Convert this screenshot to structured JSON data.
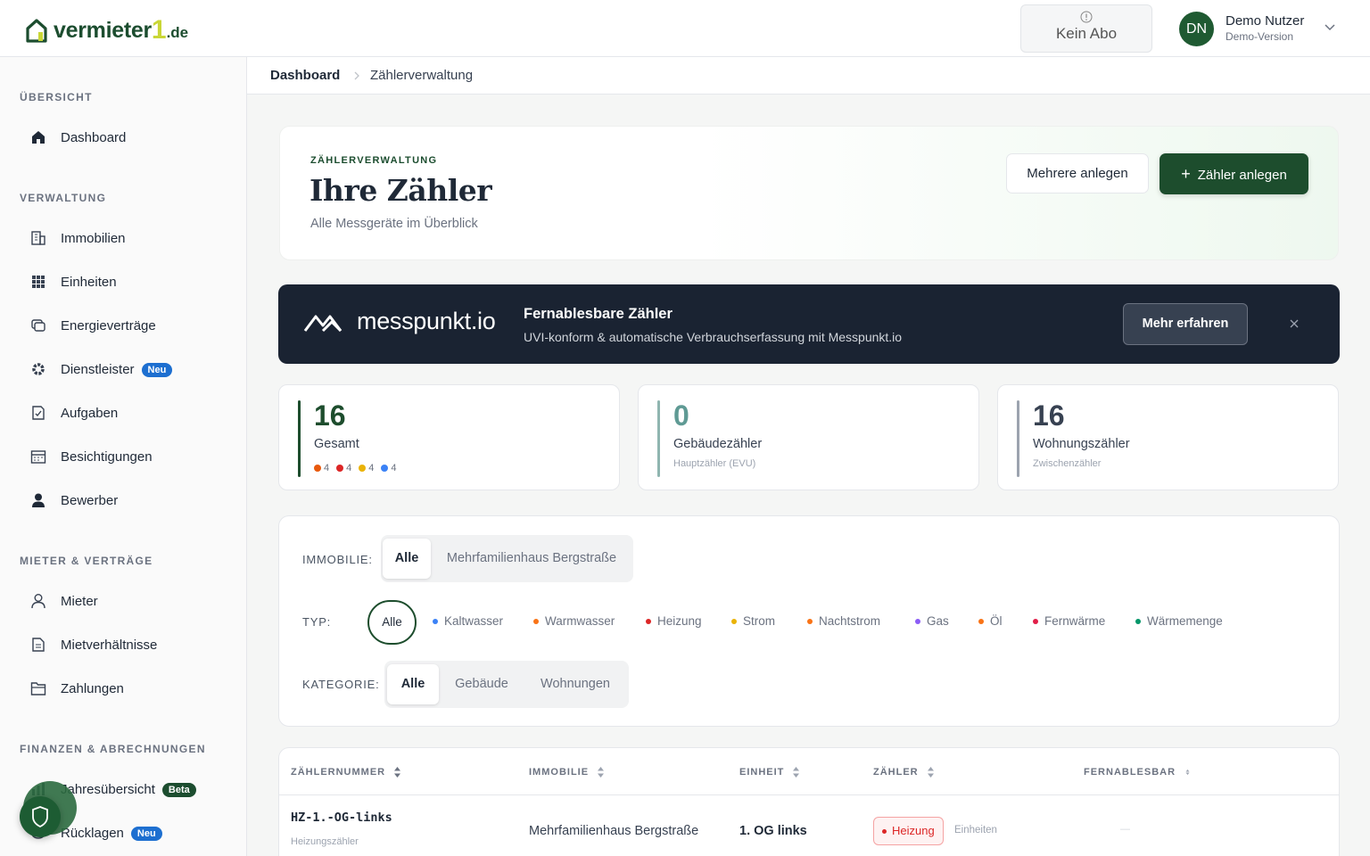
{
  "header": {
    "logo_text": "vermieter",
    "logo_one": "1",
    "logo_domain": ".de",
    "abo_label": "Kein Abo",
    "avatar_initials": "DN",
    "user_name": "Demo Nutzer",
    "user_role": "Demo-Version"
  },
  "sidebar": {
    "sections": [
      "ÜBERSICHT",
      "VERWALTUNG",
      "MIETER & VERTRÄGE",
      "FINANZEN & ABRECHNUNGEN"
    ],
    "items": [
      {
        "label": "Dashboard",
        "icon": "home-icon"
      },
      {
        "label": "Immobilien",
        "icon": "building-icon"
      },
      {
        "label": "Einheiten",
        "icon": "grid-icon"
      },
      {
        "label": "Energieverträge",
        "icon": "contract-icon"
      },
      {
        "label": "Dienstleister",
        "icon": "gear-icon",
        "badge": "Neu"
      },
      {
        "label": "Aufgaben",
        "icon": "task-icon"
      },
      {
        "label": "Besichtigungen",
        "icon": "calendar-icon"
      },
      {
        "label": "Bewerber",
        "icon": "person-icon"
      },
      {
        "label": "Mieter",
        "icon": "user-outline-icon"
      },
      {
        "label": "Mietverhältnisse",
        "icon": "document-icon"
      },
      {
        "label": "Zahlungen",
        "icon": "folder-icon"
      },
      {
        "label": "Jahresübersicht",
        "icon": "chart-icon",
        "badge": "Beta"
      },
      {
        "label": "Rücklagen",
        "icon": "piggy-icon",
        "badge": "Neu"
      }
    ]
  },
  "breadcrumb": {
    "first": "Dashboard",
    "second": "Zählerverwaltung"
  },
  "hero": {
    "kicker": "ZÄHLERVERWALTUNG",
    "title": "Ihre Zähler",
    "subtitle": "Alle Messgeräte im Überblick",
    "btn_multi": "Mehrere anlegen",
    "btn_new": "Zähler anlegen"
  },
  "banner": {
    "brand": "messpunkt.io",
    "title": "Fernablesbare Zähler",
    "subtitle": "UVI-konform & automatische Verbrauchserfassung mit Messpunkt.io",
    "button": "Mehr erfahren"
  },
  "stats": [
    {
      "value": "16",
      "label": "Gesamt",
      "sub": ""
    },
    {
      "value": "0",
      "label": "Gebäudezähler",
      "sub": "Hauptzähler (EVU)"
    },
    {
      "value": "16",
      "label": "Wohnungszähler",
      "sub": "Zwischenzähler"
    }
  ],
  "stat_breakdown": [
    {
      "count": "4",
      "color": "#e8590c"
    },
    {
      "count": "4",
      "color": "#dc2626"
    },
    {
      "count": "4",
      "color": "#eab308"
    },
    {
      "count": "4",
      "color": "#3b82f6"
    }
  ],
  "filters": {
    "immobilie_label": "IMMOBILIE:",
    "immobilie_options": [
      "Alle",
      "Mehrfamilienhaus Bergstraße"
    ],
    "typ_label": "TYP:",
    "typ_all": "Alle",
    "typ_options": [
      {
        "label": "Kaltwasser",
        "color": "#3b82f6"
      },
      {
        "label": "Warmwasser",
        "color": "#f97316"
      },
      {
        "label": "Heizung",
        "color": "#dc2626"
      },
      {
        "label": "Strom",
        "color": "#eab308"
      },
      {
        "label": "Nachtstrom",
        "color": "#f97316"
      },
      {
        "label": "Gas",
        "color": "#8b5cf6"
      },
      {
        "label": "Öl",
        "color": "#f97316"
      },
      {
        "label": "Fernwärme",
        "color": "#e11d48"
      },
      {
        "label": "Wärmemenge",
        "color": "#059669"
      }
    ],
    "kategorie_label": "KATEGORIE:",
    "kategorie_options": [
      "Alle",
      "Gebäude",
      "Wohnungen"
    ]
  },
  "table": {
    "headers": [
      "ZÄHLERNUMMER",
      "IMMOBILIE",
      "EINHEIT",
      "ZÄHLER",
      "FERNABLESBAR"
    ],
    "rows": [
      {
        "number": "HZ-1.-OG-links",
        "number_sub": "Heizungszähler",
        "immobilie": "Mehrfamilienhaus Bergstraße",
        "einheit": "1. OG links",
        "zaehler": "Heizung",
        "zaehler_extra": "Einheiten",
        "fernablesbar": "—"
      }
    ]
  },
  "colors": {
    "brand_green": "#1d4d2d",
    "banner_bg": "#1a2332",
    "stat_bar_gesamt": "#1d4d2d",
    "stat_bar_gebaeude": "#8fb5b0",
    "stat_bar_wohnung": "#9ca3af",
    "stat_num_gesamt": "#1d4d2d",
    "stat_num_gebaeude": "#5f9a94",
    "stat_num_wohnung": "#374151"
  }
}
